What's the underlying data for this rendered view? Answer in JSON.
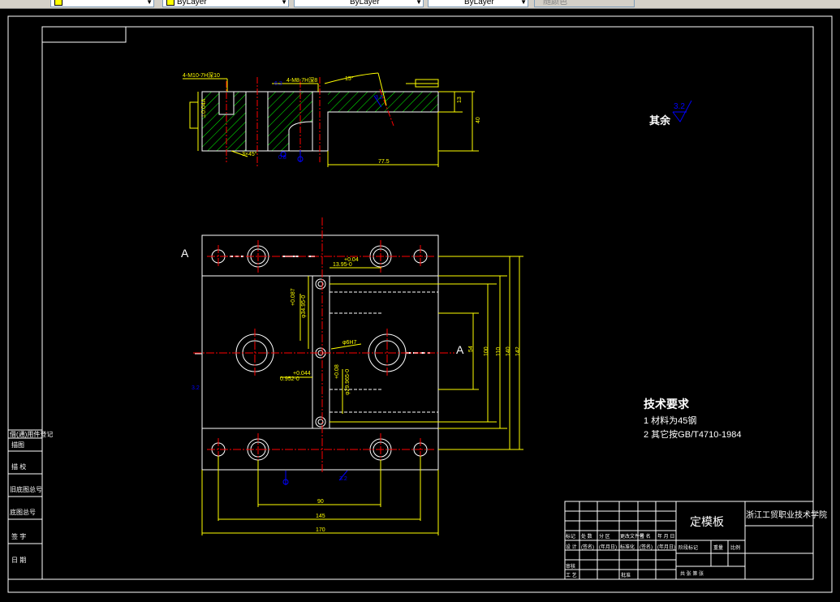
{
  "toolbar": {
    "layer_value": "",
    "color_value": "ByLayer",
    "linetype_value": "ByLayer",
    "lineweight_value": "ByLayer",
    "plotstyle_value": "随颜色"
  },
  "colors": {
    "background": "#000000",
    "frame": "#ffffff",
    "dimension": "#ffff00",
    "hatch": "#00ff00",
    "centerline": "#ff0000",
    "annotation": "#0000ff",
    "text": "#ffffff"
  },
  "drawing": {
    "roughness_label": "其余",
    "roughness_value": "3.2",
    "section_label_left": "A",
    "section_label_right": "A",
    "tech_req_title": "技术要求",
    "tech_req_line1": "1  材料为45钢",
    "tech_req_line2": "2  其它按GB/T4710-1984",
    "dims": {
      "d_775": "77.5",
      "d_90": "90",
      "d_145": "145",
      "d_170": "170",
      "d_54": "54",
      "d_100": "100",
      "d_110": "110",
      "d_140": "140",
      "d_142": "142",
      "d_40": "40",
      "d_13": "13",
      "d_1395": "13.95-0",
      "d_004": "+0.04",
      "d_0044": "+0.044",
      "d_0952": "0.952-0",
      "d_phi17": "φ6H7",
      "d_15": "15°",
      "d_3x45": "3×45°",
      "note_top1": "4-M10-7H深10",
      "note_top2": "4-M8-7H深8",
      "d_phi38": "φ34.95-0",
      "d_phi29": "φ29.965-0",
      "d_0087": "+0.087",
      "d_008": "+0.08"
    }
  },
  "sidebar_labels": [
    "描图",
    "描 校",
    "旧底图总号",
    "底图总号",
    "签 字",
    "日 期"
  ],
  "sidebar_top_label": "借(通)用件登记",
  "title_block": {
    "part_name": "定模板",
    "school": "浙江工贸职业技术学院",
    "row_labels": [
      "标记",
      "处 数",
      "分 区",
      "更改文件号",
      "签 名",
      "年 月 日"
    ],
    "row2_labels": [
      "设 计",
      "(签名)",
      "(年月日)",
      "标准化",
      "(签名)",
      "(年月日)"
    ],
    "stage_labels": [
      "阶段标记",
      "重量",
      "比例"
    ],
    "review": "审核",
    "process": "工 艺",
    "approve": "批准",
    "sheet_text": "共  张  第  张"
  }
}
